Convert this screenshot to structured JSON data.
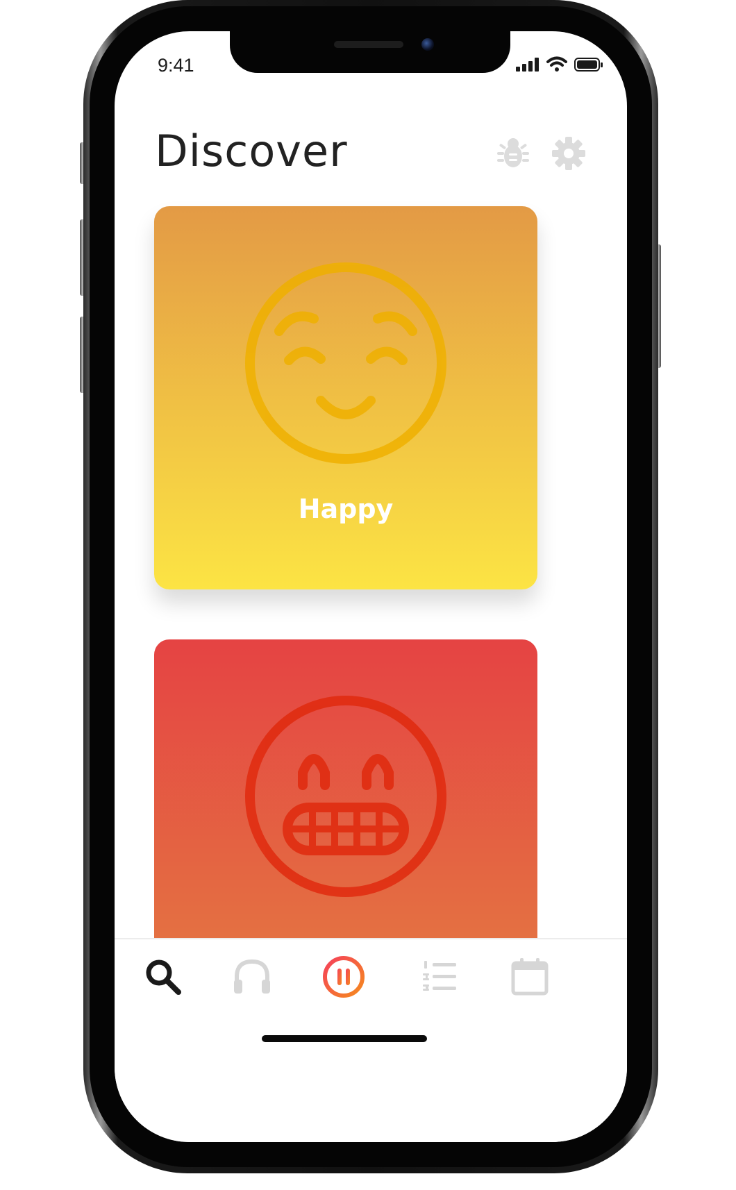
{
  "status_bar": {
    "time": "9:41",
    "icons": [
      "signal-icon",
      "wifi-icon",
      "battery-icon"
    ]
  },
  "header": {
    "title": "Discover",
    "actions": [
      {
        "icon": "bug-icon",
        "color": "#dcdcdc"
      },
      {
        "icon": "gear-icon",
        "color": "#dcdcdc"
      }
    ]
  },
  "mood_cards": [
    {
      "label": "Happy",
      "icon": "smiling-face-icon",
      "gradient_top": "#e39a45",
      "gradient_bottom": "#fce444",
      "icon_color": "#f0b400"
    },
    {
      "label": "",
      "icon": "grinning-face-icon",
      "gradient_top": "#e54343",
      "gradient_bottom": "#e47d42",
      "icon_color": "#e12a10"
    }
  ],
  "tab_bar": {
    "tabs": [
      {
        "icon": "search-icon",
        "active": true,
        "color": "#1a1a1a"
      },
      {
        "icon": "headphones-icon",
        "active": false,
        "color": "#d6d6d6"
      },
      {
        "icon": "pause-icon",
        "active": false,
        "color": "#f26a2a"
      },
      {
        "icon": "numbered-list-icon",
        "active": false,
        "color": "#d6d6d6"
      },
      {
        "icon": "calendar-icon",
        "active": false,
        "color": "#d6d6d6"
      }
    ]
  }
}
